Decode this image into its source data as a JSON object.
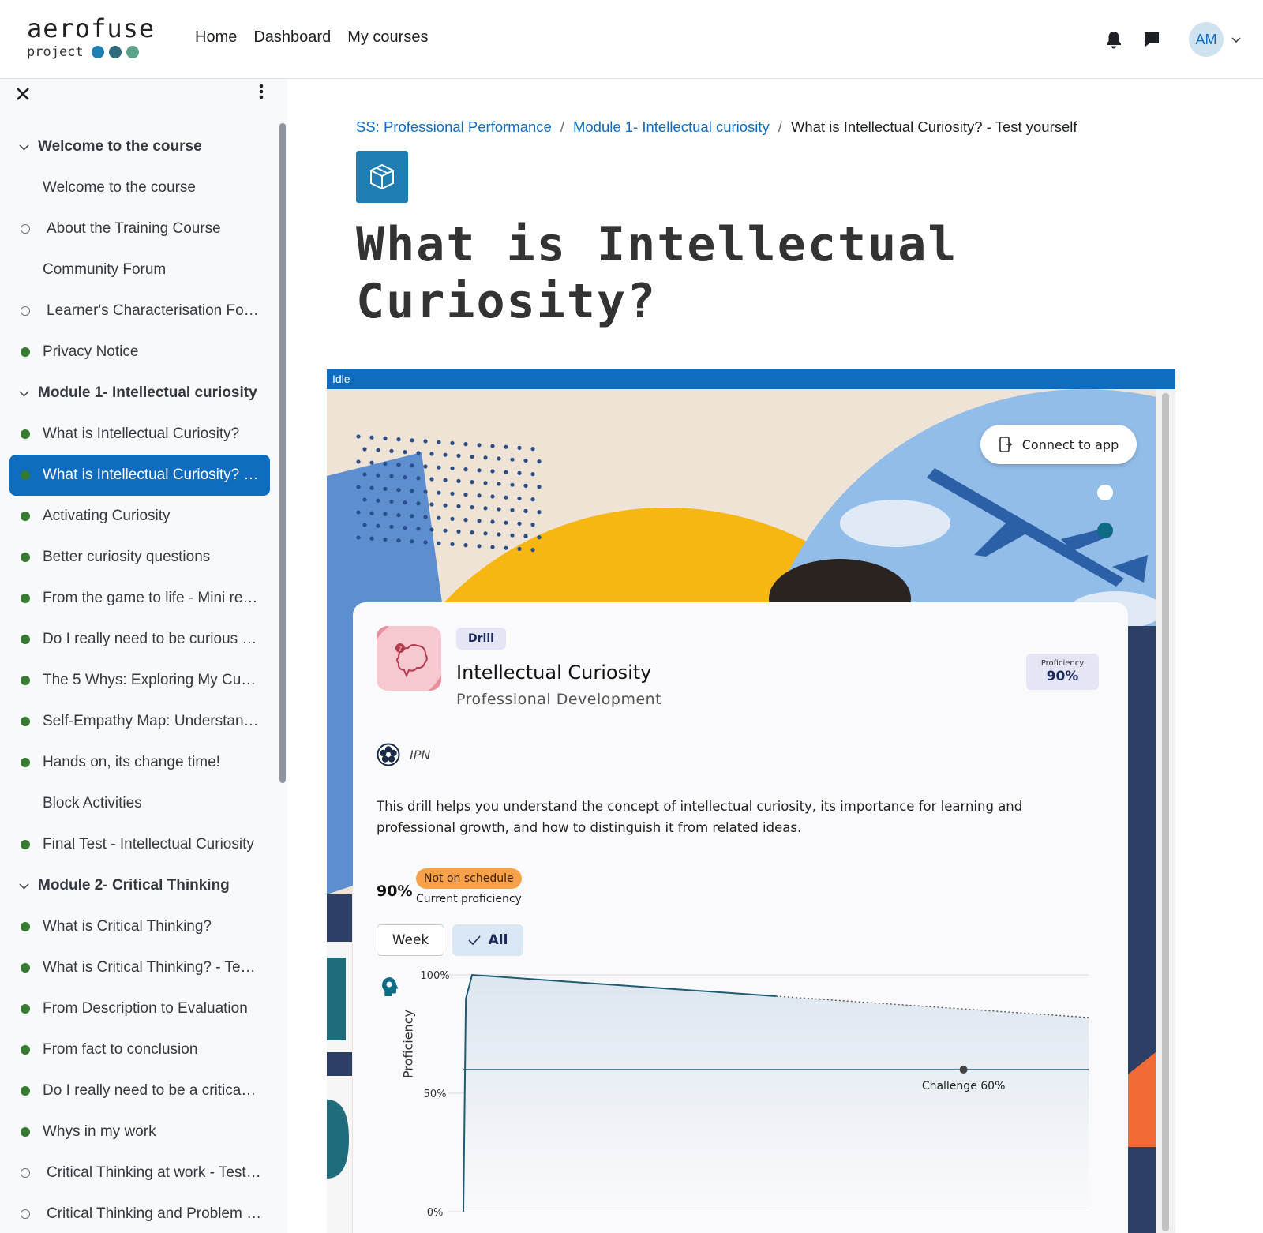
{
  "navbar": {
    "logo_word": "aerofuse",
    "logo_sub": "project",
    "links": [
      "Home",
      "Dashboard",
      "My courses"
    ],
    "avatar_initials": "AM",
    "logo_dot_colors": [
      "#1f7fb3",
      "#2f6b7a",
      "#5aa38a"
    ]
  },
  "drawer": {
    "items": [
      {
        "type": "section",
        "label": "Welcome to the course"
      },
      {
        "type": "item",
        "label": "Welcome to the course",
        "status": "none"
      },
      {
        "type": "item",
        "label": "About the Training Course",
        "status": "todo"
      },
      {
        "type": "item",
        "label": "Community Forum",
        "status": "none"
      },
      {
        "type": "item",
        "label": "Learner's Characterisation Fo…",
        "status": "todo"
      },
      {
        "type": "item",
        "label": "Privacy Notice",
        "status": "done"
      },
      {
        "type": "section",
        "label": "Module 1- Intellectual curiosity"
      },
      {
        "type": "item",
        "label": "What is Intellectual Curiosity?",
        "status": "done"
      },
      {
        "type": "item",
        "label": "What is Intellectual Curiosity? …",
        "status": "done",
        "active": true
      },
      {
        "type": "item",
        "label": "Activating Curiosity",
        "status": "done"
      },
      {
        "type": "item",
        "label": "Better curiosity questions",
        "status": "done"
      },
      {
        "type": "item",
        "label": "From the game to life - Mini re…",
        "status": "done"
      },
      {
        "type": "item",
        "label": "Do I really need to be curious …",
        "status": "done"
      },
      {
        "type": "item",
        "label": "The 5 Whys: Exploring My Cu…",
        "status": "done"
      },
      {
        "type": "item",
        "label": "Self-Empathy Map: Understan…",
        "status": "done"
      },
      {
        "type": "item",
        "label": "Hands on, its change time!",
        "status": "done"
      },
      {
        "type": "item",
        "label": "Block Activities",
        "status": "none"
      },
      {
        "type": "item",
        "label": "Final Test - Intellectual Curiosity",
        "status": "done"
      },
      {
        "type": "section",
        "label": "Module 2- Critical Thinking"
      },
      {
        "type": "item",
        "label": "What is Critical Thinking?",
        "status": "done"
      },
      {
        "type": "item",
        "label": "What is Critical Thinking? - Te…",
        "status": "done"
      },
      {
        "type": "item",
        "label": "From Description to Evaluation",
        "status": "done"
      },
      {
        "type": "item",
        "label": "From fact to conclusion",
        "status": "done"
      },
      {
        "type": "item",
        "label": "Do I really need to be a critica…",
        "status": "done"
      },
      {
        "type": "item",
        "label": "Whys in my work",
        "status": "done"
      },
      {
        "type": "item",
        "label": "Critical Thinking at work - Test…",
        "status": "todo"
      },
      {
        "type": "item",
        "label": "Critical Thinking and Problem …",
        "status": "todo"
      }
    ]
  },
  "breadcrumb": {
    "course": "SS: Professional Performance",
    "section": "Module 1- Intellectual curiosity",
    "current": "What is Intellectual Curiosity? - Test yourself",
    "separator": "/"
  },
  "page": {
    "title": "What is Intellectual Curiosity?"
  },
  "frame": {
    "status": "Idle",
    "connect_label": "Connect to app"
  },
  "drill": {
    "tag": "Drill",
    "title": "Intellectual Curiosity",
    "subtitle": "Professional Development",
    "proficiency_label": "Proficiency",
    "proficiency_value": "90%",
    "org": "IPN",
    "description": "This drill helps you understand the concept of intellectual curiosity, its importance for learning and professional growth, and how to distinguish it from related ideas.",
    "current_value": "90%",
    "schedule_status": "Not on schedule",
    "current_label": "Current proficiency",
    "range_week": "Week",
    "range_all": "All"
  },
  "chart_data": {
    "type": "area",
    "ylabel": "Proficiency",
    "yticks": [
      "100%",
      "50%",
      "0%"
    ],
    "ylim": [
      0,
      100
    ],
    "x": [
      0,
      0.4,
      1.4,
      50,
      100
    ],
    "actual": [
      0,
      90,
      100,
      91,
      null
    ],
    "projected_x": [
      50,
      100
    ],
    "projected": [
      91,
      82
    ],
    "challenge": {
      "value": 60,
      "label": "Challenge 60%",
      "marker_x": 80
    },
    "grid": true
  },
  "colors": {
    "brand_blue": "#0f6cbf",
    "done_green": "#357a32",
    "schedule_orange": "#f7a24a",
    "chart_line": "#1f5c73"
  }
}
